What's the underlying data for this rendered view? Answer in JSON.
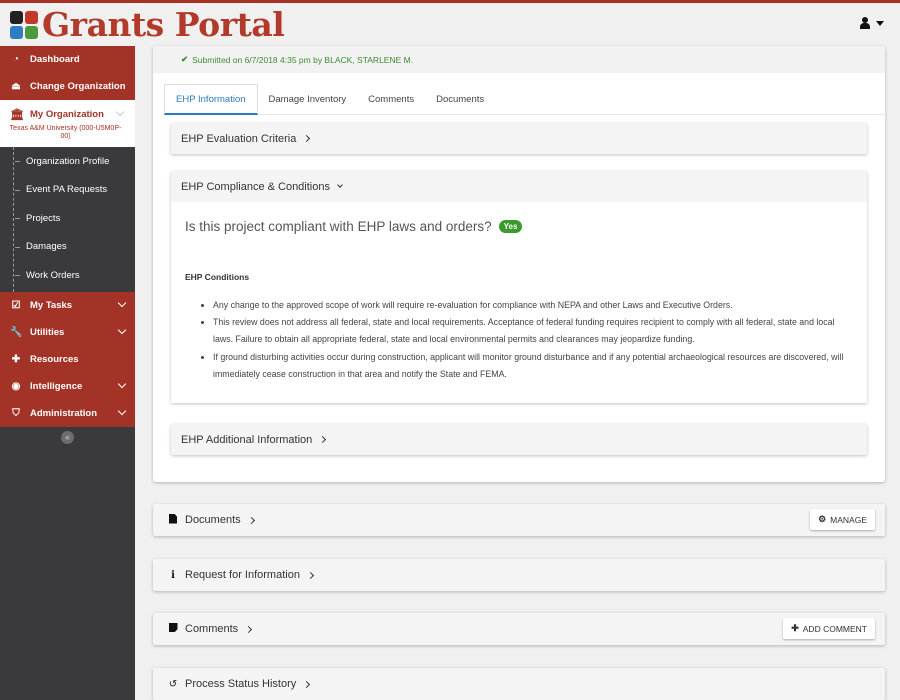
{
  "header": {
    "app_title": "Grants Portal",
    "user_icon": "user-icon",
    "user_menu_caret": "caret-down-icon"
  },
  "sidebar": {
    "top_items": [
      {
        "label": "Dashboard",
        "icon": "dashboard-icon"
      },
      {
        "label": "Change Organization",
        "icon": "eject-icon"
      }
    ],
    "my_org": {
      "label": "My Organization",
      "icon": "institution-icon",
      "org_name": "Texas A&M University (000-U5M0P-00)",
      "sub_items": [
        {
          "label": "Organization Profile"
        },
        {
          "label": "Event PA Requests"
        },
        {
          "label": "Projects"
        },
        {
          "label": "Damages"
        },
        {
          "label": "Work Orders"
        }
      ]
    },
    "bottom_items": [
      {
        "label": "My Tasks",
        "icon": "checkbox-icon",
        "expandable": true
      },
      {
        "label": "Utilities",
        "icon": "wrench-icon",
        "expandable": true
      },
      {
        "label": "Resources",
        "icon": "medkit-icon",
        "expandable": false
      },
      {
        "label": "Intelligence",
        "icon": "eye-icon",
        "expandable": true
      },
      {
        "label": "Administration",
        "icon": "shield-icon",
        "expandable": true
      }
    ],
    "collapse_glyph": "«"
  },
  "main": {
    "submitted_text": "Submitted on 6/7/2018 4:35 pm by BLACK, STARLENE M.",
    "tabs": [
      {
        "label": "EHP Information",
        "active": true
      },
      {
        "label": "Damage Inventory",
        "active": false
      },
      {
        "label": "Comments",
        "active": false
      },
      {
        "label": "Documents",
        "active": false
      }
    ],
    "panels": {
      "evaluation": {
        "title": "EHP Evaluation Criteria",
        "expanded": false
      },
      "compliance": {
        "title": "EHP Compliance & Conditions",
        "expanded": true,
        "question": "Is this project compliant with EHP laws and orders?",
        "answer": "Yes",
        "conditions_title": "EHP Conditions",
        "conditions": [
          "Any change to the approved scope of work will require re-evaluation for compliance with NEPA and other Laws and Executive Orders.",
          "This review does not address all federal, state and local requirements. Acceptance of federal funding requires recipient to comply with all federal, state and local laws. Failure to obtain all appropriate federal, state and local environmental permits and clearances may jeopardize funding.",
          "If ground disturbing activities occur during construction, applicant will monitor ground disturbance and if any potential archaeological resources are discovered, will immediately cease construction in that area and notify the State and FEMA."
        ]
      },
      "additional": {
        "title": "EHP Additional Information",
        "expanded": false
      }
    },
    "sections": [
      {
        "title": "Documents",
        "icon": "file-icon",
        "button": {
          "label": "MANAGE",
          "icon": "gear-icon"
        }
      },
      {
        "title": "Request for Information",
        "icon": "info-icon"
      },
      {
        "title": "Comments",
        "icon": "sticky-note-icon",
        "button": {
          "label": "ADD COMMENT",
          "icon": "plus-icon"
        }
      },
      {
        "title": "Process Status History",
        "icon": "history-icon"
      }
    ]
  },
  "colors": {
    "brand_red": "#a33327",
    "logo_red": "#b23a2a",
    "sidebar_dark": "#3a3a3c",
    "active_tab_blue": "#2b7bc0",
    "success_green": "#3c8d2f",
    "yes_badge_green": "#3a9a2c"
  }
}
